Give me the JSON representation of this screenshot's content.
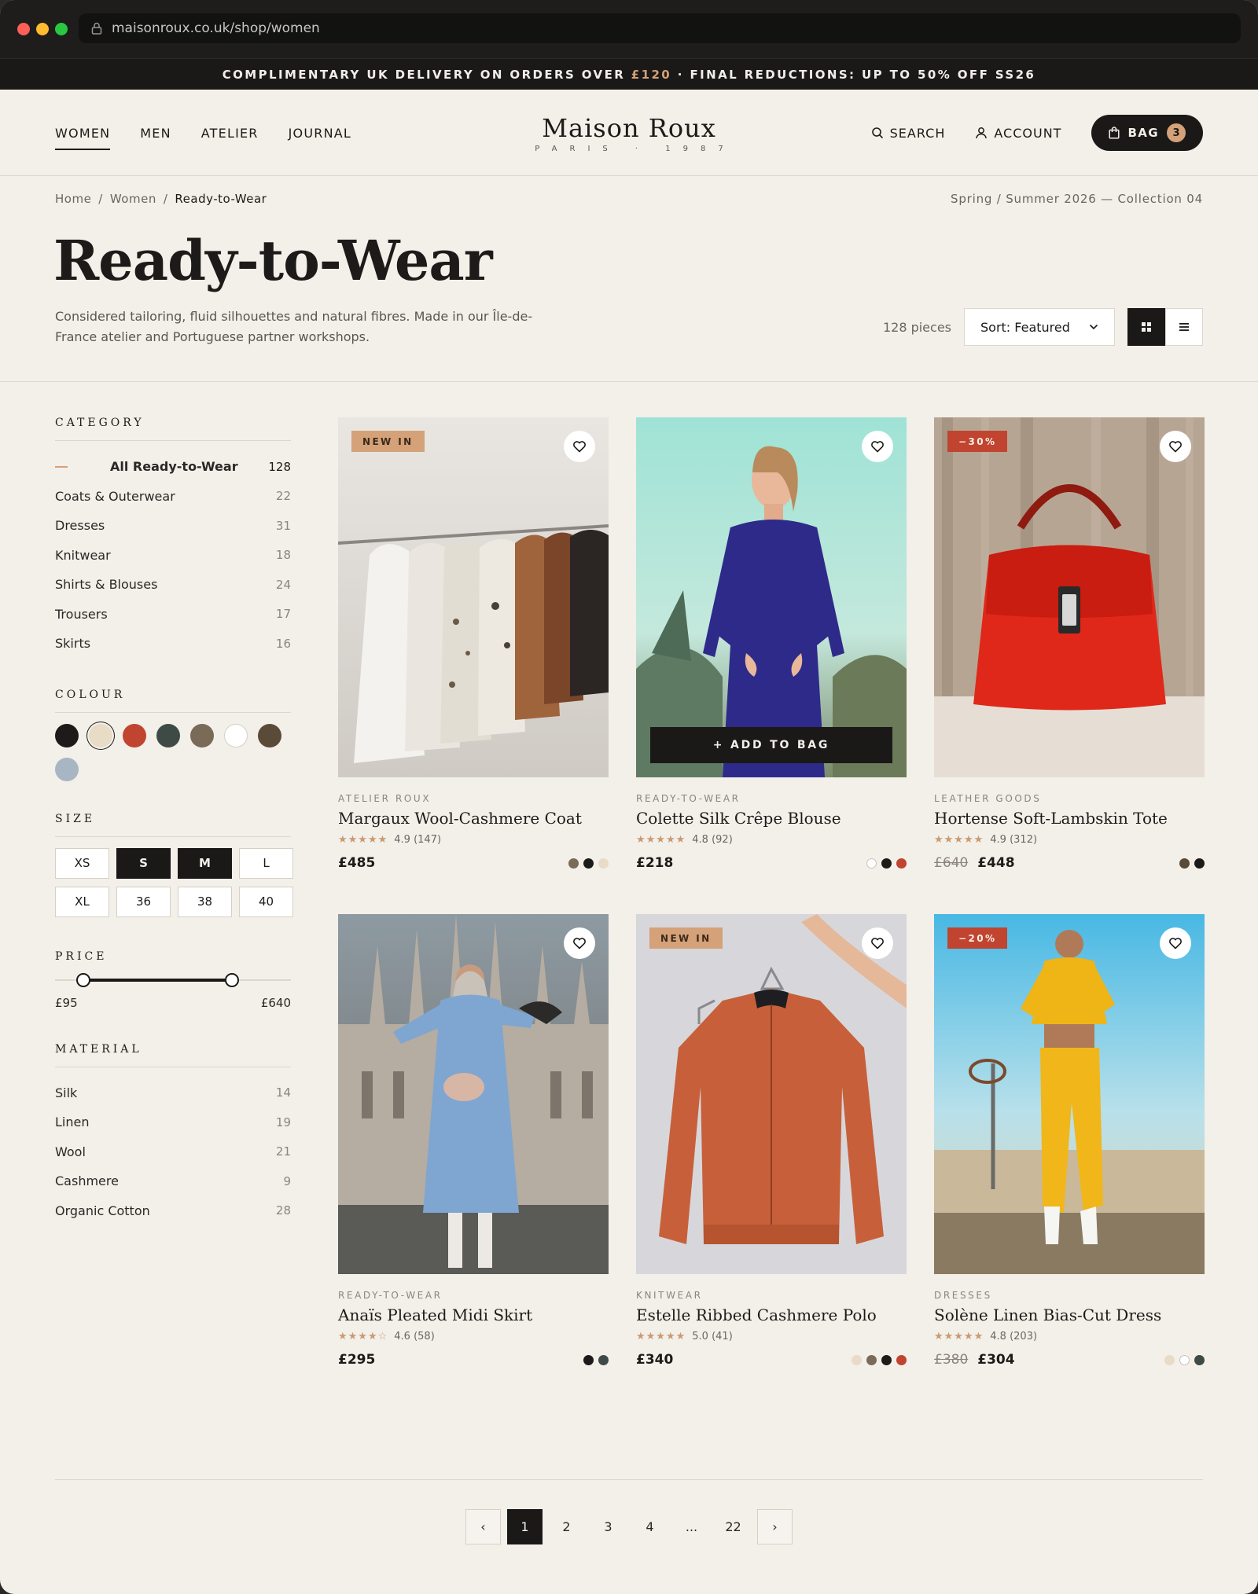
{
  "browser": {
    "url": "maisonroux.co.uk/shop/women",
    "dot_colors": [
      "#ff5f57",
      "#febc2e",
      "#28c840"
    ]
  },
  "promo": {
    "part1": "COMPLIMENTARY UK DELIVERY ON ORDERS OVER ",
    "amount": "£120",
    "part2": " · FINAL REDUCTIONS: UP TO 50% OFF SS26"
  },
  "header": {
    "nav": [
      "WOMEN",
      "MEN",
      "ATELIER",
      "JOURNAL"
    ],
    "active_nav": "WOMEN",
    "logo": "Maison Roux",
    "logo_sub": "PARIS · 1987",
    "search_label": "SEARCH",
    "account_label": "ACCOUNT",
    "bag_label": "BAG",
    "bag_count": "3"
  },
  "breadcrumb": [
    "Home",
    "Women",
    "Ready-to-Wear"
  ],
  "season": "Spring / Summer 2026 — Collection 04",
  "page": {
    "title": "Ready-to-Wear",
    "description": "Considered tailoring, fluid silhouettes and natural fibres. Made in our Île-de-France atelier and Portuguese partner workshops.",
    "pieces": "128 pieces",
    "sort": "Sort: Featured"
  },
  "filters": {
    "category_title": "CATEGORY",
    "categories": [
      {
        "label": "All Ready-to-Wear",
        "count": "128",
        "active": true
      },
      {
        "label": "Coats & Outerwear",
        "count": "22"
      },
      {
        "label": "Dresses",
        "count": "31"
      },
      {
        "label": "Knitwear",
        "count": "18"
      },
      {
        "label": "Shirts & Blouses",
        "count": "24"
      },
      {
        "label": "Trousers",
        "count": "17"
      },
      {
        "label": "Skirts",
        "count": "16"
      }
    ],
    "colour_title": "COLOUR",
    "colours": [
      "#1c1b19",
      "#e8dcc6",
      "#c0442f",
      "#3e4a45",
      "#7a6a58",
      "#ffffff",
      "#5a4a38",
      "#a8b6c4"
    ],
    "selected_colour_index": 1,
    "size_title": "SIZE",
    "sizes": [
      "XS",
      "S",
      "M",
      "L",
      "XL",
      "36",
      "38",
      "40"
    ],
    "selected_sizes": [
      "S",
      "M"
    ],
    "price_title": "PRICE",
    "price_min_label": "£95",
    "price_max_label": "£640",
    "price_range_fraction": [
      0.12,
      0.75
    ],
    "material_title": "MATERIAL",
    "materials": [
      {
        "label": "Silk",
        "count": "14"
      },
      {
        "label": "Linen",
        "count": "19"
      },
      {
        "label": "Wool",
        "count": "21"
      },
      {
        "label": "Cashmere",
        "count": "9"
      },
      {
        "label": "Organic Cotton",
        "count": "28"
      }
    ]
  },
  "products": [
    {
      "badge": "NEW IN",
      "badge_type": "new",
      "category": "ATELIER ROUX",
      "name": "Margaux Wool-Cashmere Coat",
      "stars": "★★★★★",
      "rating": "4.9 (147)",
      "old_price": "",
      "price": "£485",
      "colors": [
        "#7a6a58",
        "#1c1b19",
        "#e8dcc6"
      ],
      "scene": "rack"
    },
    {
      "badge": "",
      "badge_type": "",
      "category": "READY-TO-WEAR",
      "name": "Colette Silk Crêpe Blouse",
      "stars": "★★★★★",
      "rating": "4.8 (92)",
      "old_price": "",
      "price": "£218",
      "colors": [
        "#ffffff",
        "#1c1b19",
        "#c0442f"
      ],
      "scene": "lace",
      "add_to_bag": "+ ADD TO BAG"
    },
    {
      "badge": "−30%",
      "badge_type": "sale",
      "category": "LEATHER GOODS",
      "name": "Hortense Soft-Lambskin Tote",
      "stars": "★★★★★",
      "rating": "4.9 (312)",
      "old_price": "£640",
      "price": "£448",
      "colors": [
        "#5a4a38",
        "#1c1b19"
      ],
      "scene": "bag"
    },
    {
      "badge": "",
      "badge_type": "",
      "category": "READY-TO-WEAR",
      "name": "Anaïs Pleated Midi Skirt",
      "stars": "★★★★☆",
      "rating": "4.6 (58)",
      "old_price": "",
      "price": "£295",
      "colors": [
        "#1c1b19",
        "#3e4a45"
      ],
      "scene": "cathedral"
    },
    {
      "badge": "NEW IN",
      "badge_type": "new",
      "category": "KNITWEAR",
      "name": "Estelle Ribbed Cashmere Polo",
      "stars": "★★★★★",
      "rating": "5.0 (41)",
      "old_price": "",
      "price": "£340",
      "colors": [
        "#e8dcc6",
        "#7a6a58",
        "#1c1b19",
        "#c0442f"
      ],
      "scene": "jacket"
    },
    {
      "badge": "−20%",
      "badge_type": "sale",
      "category": "DRESSES",
      "name": "Solène Linen Bias-Cut Dress",
      "stars": "★★★★★",
      "rating": "4.8 (203)",
      "old_price": "£380",
      "price": "£304",
      "colors": [
        "#e8dcc6",
        "#ffffff",
        "#3e4a45"
      ],
      "scene": "yellow"
    }
  ],
  "pagination": {
    "prev": "‹",
    "pages": [
      "1",
      "2",
      "3",
      "4",
      "...",
      "22"
    ],
    "current": "1",
    "next": "›"
  }
}
